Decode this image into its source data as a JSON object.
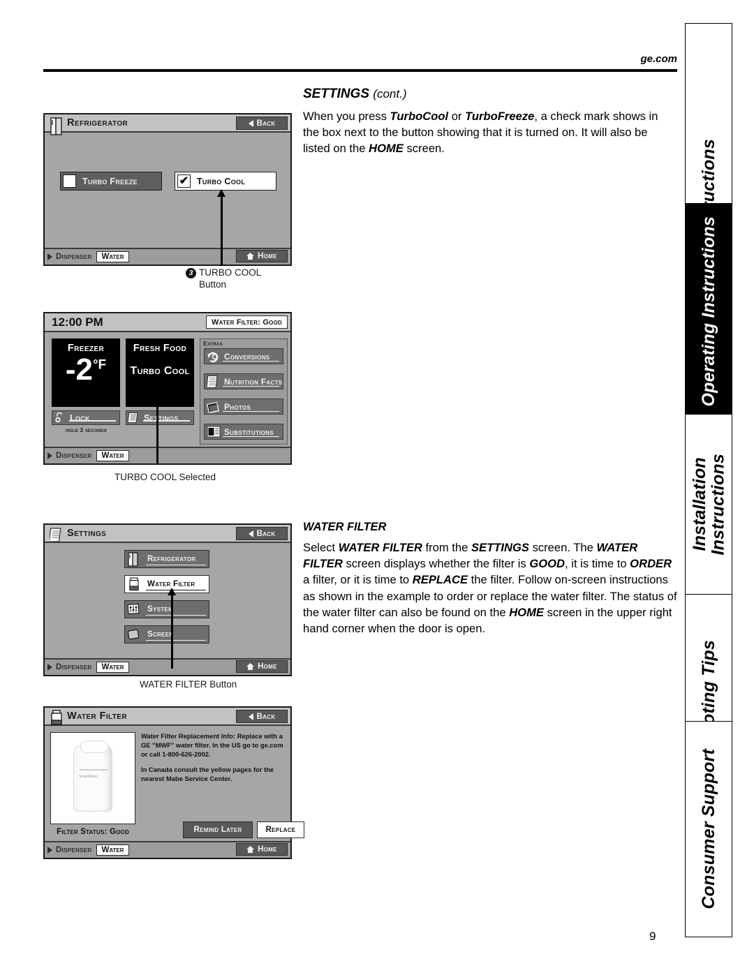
{
  "page": {
    "site_url": "ge.com",
    "page_number": "9"
  },
  "side_tabs": [
    {
      "label": "Safety Instructions",
      "active": false
    },
    {
      "label": "Operating Instructions",
      "active": true
    },
    {
      "label": "Installation\nInstructions",
      "active": false
    },
    {
      "label": "Troubleshooting Tips",
      "active": false
    },
    {
      "label": "Consumer Support",
      "active": false
    }
  ],
  "settings_section": {
    "heading_main": "SETTINGS",
    "heading_cont": "(cont.)",
    "paragraph": "When you press TurboCool or TurboFreeze, a check mark shows in the box next to the button showing that it is turned on. It will also be listed on the HOME screen."
  },
  "water_filter_section": {
    "heading": "WATER FILTER",
    "paragraph": "Select WATER FILTER from the SETTINGS screen. The WATER FILTER screen displays whether the filter is GOOD, it is time to ORDER a filter, or it is time to REPLACE the filter. Follow on-screen instructions as shown in the example to order or replace the water filter. The status of the water filter can also be found on the HOME screen in the upper right hand corner when the door is open."
  },
  "screens": {
    "refrigerator": {
      "title": "Refrigerator",
      "back_label": "Back",
      "home_label": "Home",
      "dispenser_label": "Dispenser",
      "water_label": "Water",
      "toggles": [
        {
          "label": "Turbo Freeze",
          "checked": false
        },
        {
          "label": "Turbo Cool",
          "checked": true
        }
      ],
      "caption_badge": "3",
      "caption_line1": "TURBO COOL",
      "caption_line2": "Button"
    },
    "home": {
      "clock": "12:00 PM",
      "filter_status": "Water Filter: Good",
      "dispenser_label": "Dispenser",
      "water_label": "Water",
      "freezer": {
        "zone": "Freezer",
        "value": "-2",
        "unit": "°F"
      },
      "fresh_food": {
        "zone": "Fresh Food",
        "mode": "Turbo Cool"
      },
      "lock_label": "Lock",
      "lock_note": "hold 3 seconds",
      "settings_label": "Settings",
      "extras_label": "Extras",
      "extras": [
        {
          "label": "Conversions",
          "icon": "conversions-icon"
        },
        {
          "label": "Nutrition Facts",
          "icon": "nutrition-facts-icon"
        },
        {
          "label": "Photos",
          "icon": "photos-icon"
        },
        {
          "label": "Substitutions",
          "icon": "substitutions-icon"
        }
      ],
      "caption": "TURBO COOL Selected"
    },
    "settings": {
      "title": "Settings",
      "back_label": "Back",
      "home_label": "Home",
      "dispenser_label": "Dispenser",
      "water_label": "Water",
      "items": [
        {
          "label": "Refrigerator",
          "selected": false
        },
        {
          "label": "Water Filter",
          "selected": true
        },
        {
          "label": "System",
          "selected": false
        },
        {
          "label": "Screen",
          "selected": false
        }
      ],
      "caption": "WATER FILTER Button"
    },
    "water_filter": {
      "title": "Water Filter",
      "back_label": "Back",
      "home_label": "Home",
      "dispenser_label": "Dispenser",
      "water_label": "Water",
      "info_paragraph_1": "Water Filter Replacement Info: Replace with a GE \"MWF\" water filter. In the US go to ge.com or call 1-800-626-2002.",
      "info_paragraph_2": "In Canada consult the yellow pages for the nearest Mabe Service Center.",
      "filter_status": "Filter Status: Good",
      "remind_label": "Remind Later",
      "replace_label": "Replace"
    }
  },
  "colors": {
    "screen_bg": "#a6a6a6",
    "title_bar": "#c2c2c2",
    "button_dark": "#5e5e5e",
    "tile_black": "#000000",
    "accent_white": "#ffffff"
  }
}
